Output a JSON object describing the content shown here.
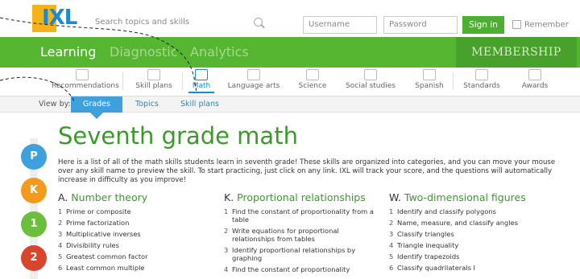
{
  "header": {
    "logo_text": "IXL",
    "search_placeholder": "Search topics and skills",
    "username_placeholder": "Username",
    "password_placeholder": "Password",
    "signin_label": "Sign in",
    "remember_label": "Remember"
  },
  "nav": {
    "tabs": [
      "Learning",
      "Diagnostic",
      "Analytics"
    ],
    "membership": "MEMBERSHIP"
  },
  "subjects": {
    "items": [
      {
        "label": "Recommendations",
        "icon": "recommendations-icon"
      },
      {
        "label": "Skill plans",
        "icon": "skill-plans-icon"
      },
      {
        "label": "Math",
        "icon": "math-icon"
      },
      {
        "label": "Language arts",
        "icon": "language-arts-icon"
      },
      {
        "label": "Science",
        "icon": "science-icon"
      },
      {
        "label": "Social studies",
        "icon": "social-studies-icon"
      },
      {
        "label": "Spanish",
        "icon": "spanish-icon"
      },
      {
        "label": "Standards",
        "icon": "standards-icon"
      },
      {
        "label": "Awards",
        "icon": "awards-icon"
      }
    ],
    "active": "Math"
  },
  "viewby": {
    "label": "View by:",
    "options": [
      "Grades",
      "Topics",
      "Skill plans"
    ]
  },
  "grades": [
    {
      "label": "P",
      "color": "#3ea0dc"
    },
    {
      "label": "K",
      "color": "#f39a1e"
    },
    {
      "label": "1",
      "color": "#6cbf3c"
    },
    {
      "label": "2",
      "color": "#d9452c"
    }
  ],
  "page": {
    "title": "Seventh grade math",
    "intro": "Here is a list of all of the math skills students learn in seventh grade! These skills are organized into categories, and you can move your mouse over any skill name to preview the skill. To start practicing, just click on any link. IXL will track your score, and the questions will automatically increase in difficulty as you improve!"
  },
  "categories": [
    {
      "letter": "A.",
      "name": "Number theory",
      "skills": [
        "Prime or composite",
        "Prime factorization",
        "Multiplicative inverses",
        "Divisibility rules",
        "Greatest common factor",
        "Least common multiple"
      ]
    },
    {
      "letter": "K.",
      "name": "Proportional relationships",
      "skills": [
        "Find the constant of proportionality from a table",
        "Write equations for proportional relationships from tables",
        "Identify proportional relationships by graphing",
        "Find the constant of proportionality"
      ]
    },
    {
      "letter": "W.",
      "name": "Two-dimensional figures",
      "skills": [
        "Identify and classify polygons",
        "Name, measure, and classify angles",
        "Classify triangles",
        "Triangle inequality",
        "Identify trapezoids",
        "Classify quadrilaterals I"
      ]
    }
  ]
}
